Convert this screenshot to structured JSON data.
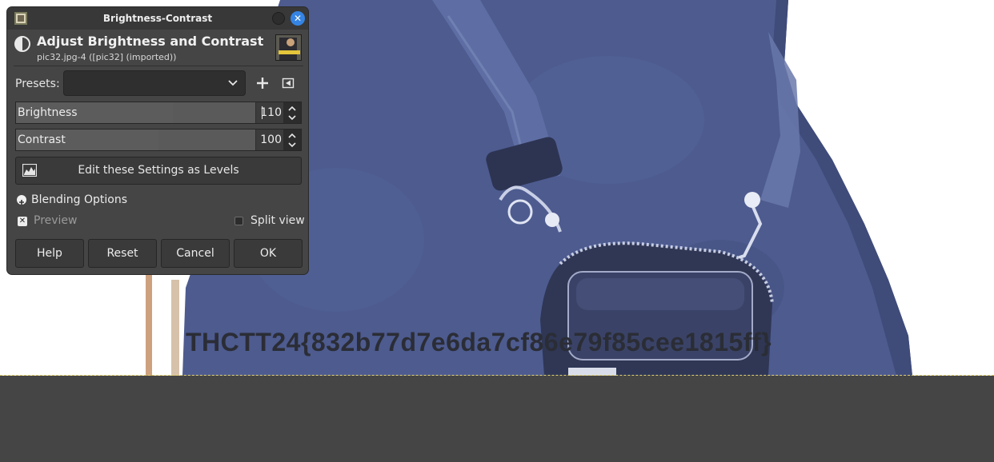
{
  "dialog": {
    "window_title": "Brightness-Contrast",
    "header_title": "Adjust Brightness and Contrast",
    "header_subtitle": "pic32.jpg-4 ([pic32] (imported))",
    "presets_label": "Presets:",
    "presets_value": "",
    "brightness": {
      "label": "Brightness",
      "value": "110"
    },
    "contrast": {
      "label": "Contrast",
      "value": "100"
    },
    "levels_button_label": "Edit these Settings as Levels",
    "blending_options_label": "Blending Options",
    "preview": {
      "label": "Preview",
      "checked": true
    },
    "split_view": {
      "label": "Split view",
      "checked": false
    },
    "buttons": {
      "help": "Help",
      "reset": "Reset",
      "cancel": "Cancel",
      "ok": "OK"
    },
    "icons": {
      "app": "gimp-icon",
      "header": "brightness-contrast-icon",
      "add_preset": "plus-icon",
      "manage_presets": "menu-triangle-icon",
      "levels": "levels-icon",
      "blending": "expander-icon"
    }
  },
  "canvas": {
    "watermark_text": "THCTT24{832b77d7e6da7cf86e79f85cee1815ff}"
  },
  "colors": {
    "accent": "#3584e4",
    "dialog_bg": "#454545",
    "bag_blue": "#4c5a8e"
  }
}
